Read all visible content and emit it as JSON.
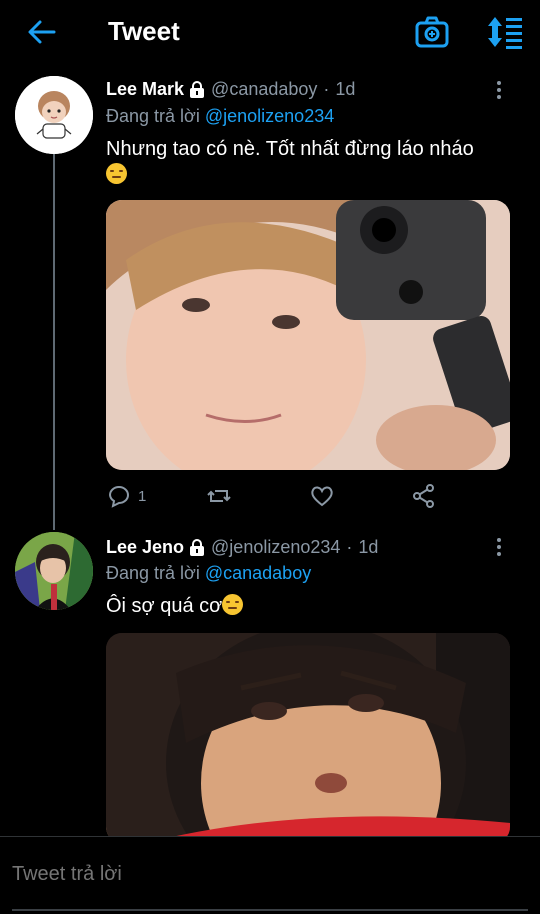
{
  "header": {
    "title": "Tweet",
    "back_icon": "arrow-left-icon",
    "camera_icon": "camera-icon",
    "sort_icon": "sort-icon",
    "accent": "#1da1f2"
  },
  "tweets": [
    {
      "name": "Lee Mark",
      "handle": "@canadaboy",
      "time": "1d",
      "reply_prefix": "Đang trả lời",
      "reply_to": "@jenolizeno234",
      "text": "Nhưng tao có nè. Tốt nhất đừng láo nháo",
      "reply_count": "1"
    },
    {
      "name": "Lee Jeno",
      "handle": "@jenolizeno234",
      "time": "1d",
      "reply_prefix": "Đang trả lời",
      "reply_to": "@canadaboy",
      "text": "Ôi sợ quá cơ"
    }
  ],
  "reply_box": {
    "placeholder": "Tweet trả lời"
  },
  "colors": {
    "background": "#000000",
    "secondary_text": "#8b98a5",
    "mention": "#1da1f2"
  }
}
